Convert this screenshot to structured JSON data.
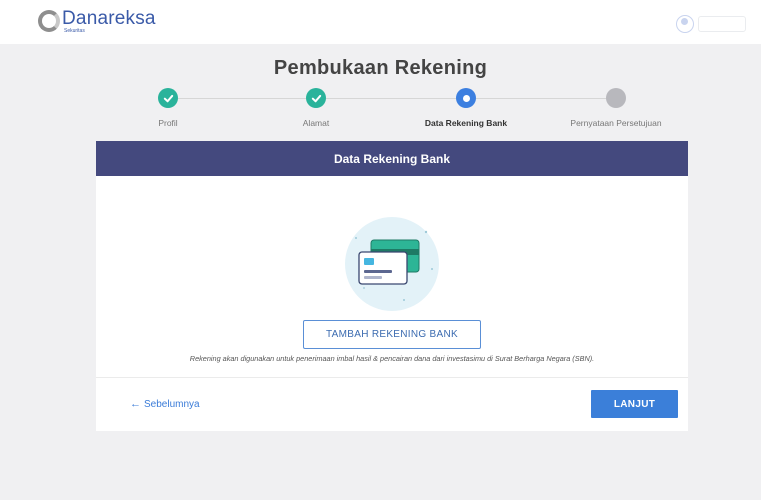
{
  "brand": {
    "name": "Danareksa",
    "subtitle": "Sekuritas"
  },
  "page": {
    "title": "Pembukaan Rekening"
  },
  "stepper": {
    "steps": [
      {
        "label": "Profil",
        "status": "done"
      },
      {
        "label": "Alamat",
        "status": "done"
      },
      {
        "label": "Data Rekening Bank",
        "status": "current"
      },
      {
        "label": "Pernyataan Persetujuan",
        "status": "pending"
      }
    ]
  },
  "card": {
    "header": "Data Rekening Bank",
    "add_button": "TAMBAH REKENING BANK",
    "note": "Rekening akan digunakan untuk penerimaan imbal hasil & pencairan dana dari investasimu di Surat Berharga Negara (SBN).",
    "back_label": "Sebelumnya",
    "next_label": "LANJUT"
  },
  "colors": {
    "brand_blue": "#3a5aa8",
    "header_bg": "#44497e",
    "done_green": "#2ab39b",
    "current_blue": "#3c7fe0",
    "pending_grey": "#b8b8bd",
    "primary_button": "#3b7fd9"
  },
  "icons": [
    "logo-mark-icon",
    "user-icon",
    "check-icon",
    "bank-cards-icon",
    "arrow-left-icon"
  ]
}
